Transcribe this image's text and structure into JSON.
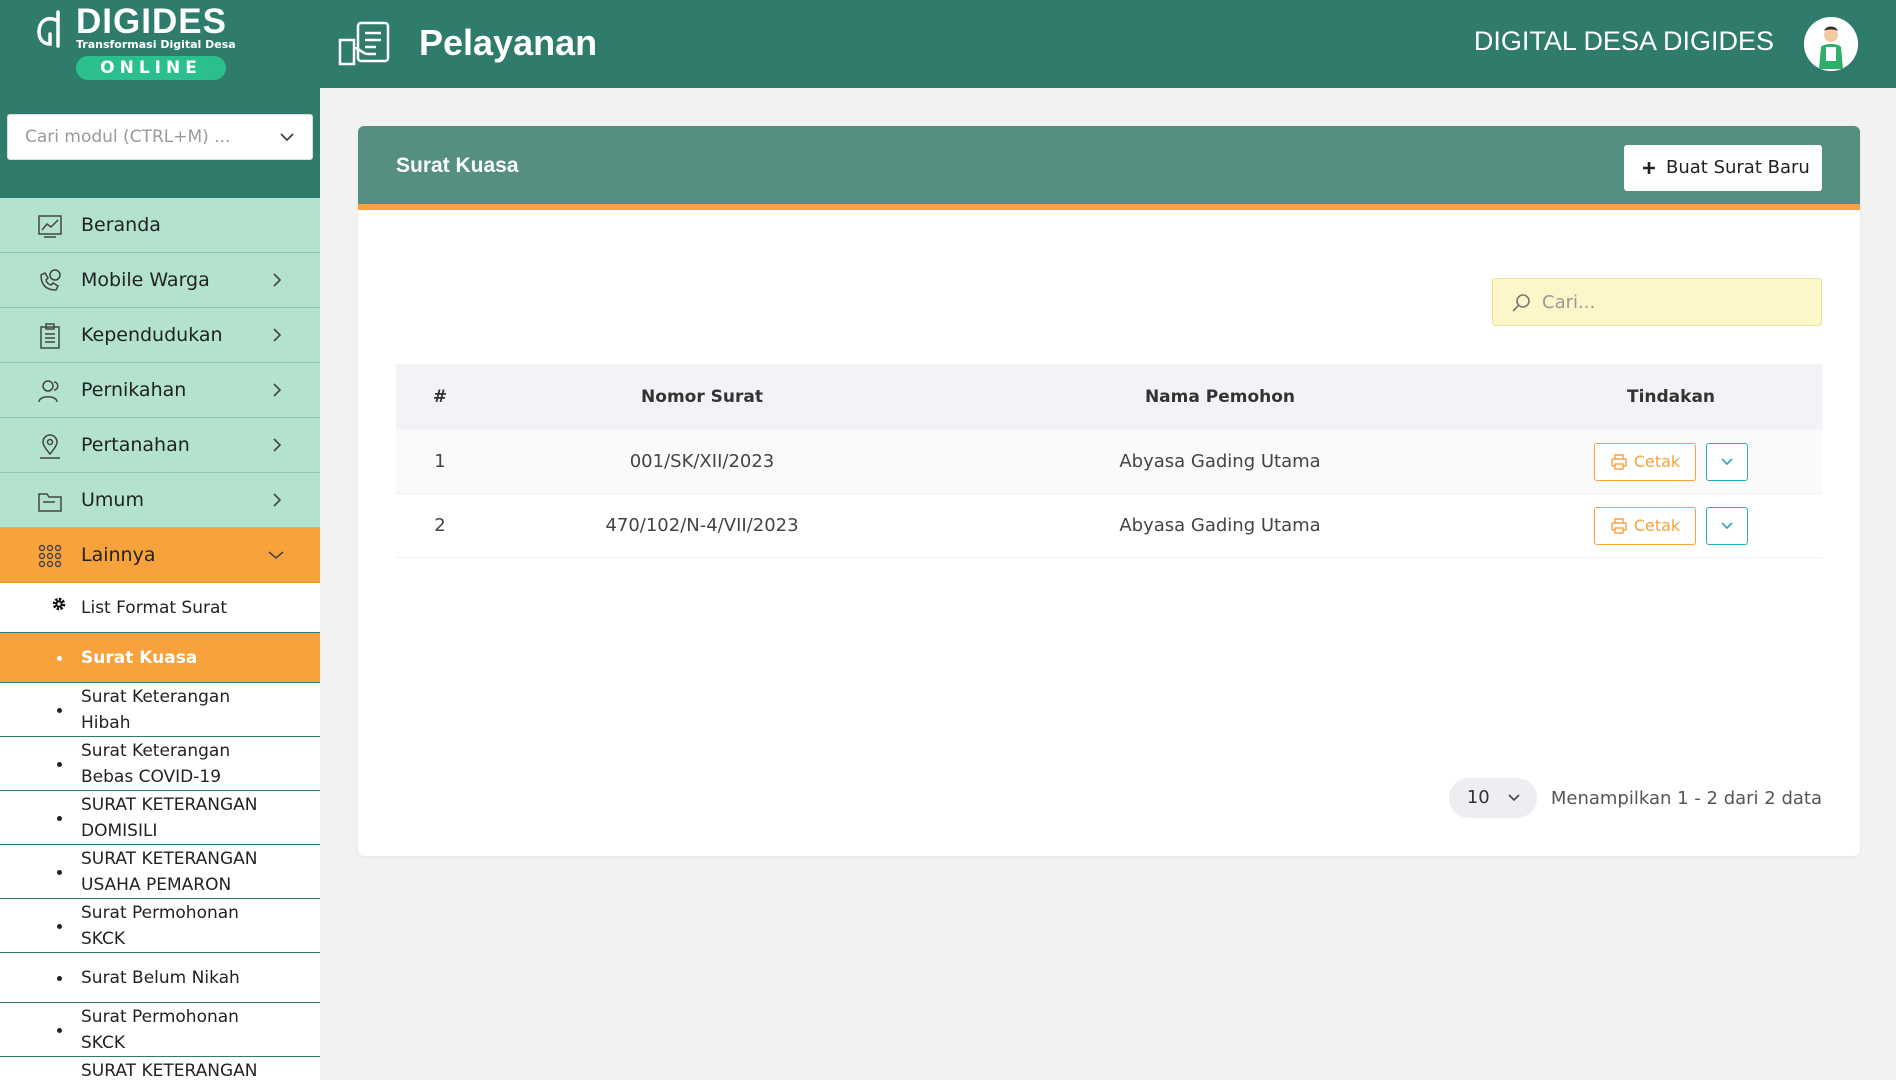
{
  "header": {
    "brand": "DIGIDES",
    "tagline": "Transformasi Digital Desa",
    "badge": "ONLINE",
    "page_title": "Pelayanan",
    "org_name": "DIGITAL DESA DIGIDES"
  },
  "sidebar": {
    "search_placeholder": "Cari modul (CTRL+M) ...",
    "items": [
      {
        "label": "Beranda",
        "icon": "chart-icon"
      },
      {
        "label": "Mobile Warga",
        "icon": "phone-icon"
      },
      {
        "label": "Kependudukan",
        "icon": "clipboard-icon"
      },
      {
        "label": "Pernikahan",
        "icon": "users-icon"
      },
      {
        "label": "Pertanahan",
        "icon": "map-pin-icon"
      },
      {
        "label": "Umum",
        "icon": "folder-icon"
      },
      {
        "label": "Lainnya",
        "icon": "grid-icon"
      }
    ],
    "sub_items": [
      {
        "label": "List Format Surat"
      },
      {
        "label": "Surat Kuasa"
      },
      {
        "label": "Surat Keterangan Hibah"
      },
      {
        "label": "Surat Keterangan Bebas COVID-19"
      },
      {
        "label": "SURAT KETERANGAN DOMISILI"
      },
      {
        "label": "SURAT KETERANGAN USAHA PEMARON"
      },
      {
        "label": "Surat Permohonan SKCK"
      },
      {
        "label": "Surat Belum Nikah"
      },
      {
        "label": "Surat Permohonan SKCK"
      },
      {
        "label": "SURAT KETERANGAN"
      }
    ]
  },
  "card": {
    "title": "Surat Kuasa",
    "new_button": "Buat Surat Baru",
    "search_placeholder": "Cari..."
  },
  "table": {
    "headers": [
      "#",
      "Nomor Surat",
      "Nama Pemohon",
      "Tindakan"
    ],
    "rows": [
      {
        "no": "1",
        "nomor_surat": "001/SK/XII/2023",
        "nama_pemohon": "Abyasa Gading Utama",
        "action": "Cetak"
      },
      {
        "no": "2",
        "nomor_surat": "470/102/N-4/VII/2023",
        "nama_pemohon": "Abyasa Gading Utama",
        "action": "Cetak"
      }
    ]
  },
  "pagination": {
    "per_page": "10",
    "info": "Menampilkan 1 - 2 dari 2 data"
  },
  "colors": {
    "header_bg": "#2f7b6c",
    "card_header_bg": "#548f81",
    "accent_orange": "#f7a23c",
    "menu_bg": "#b3e2cf",
    "search_bg": "#fdf6c8",
    "dropdown_border": "#2aa7b8"
  }
}
